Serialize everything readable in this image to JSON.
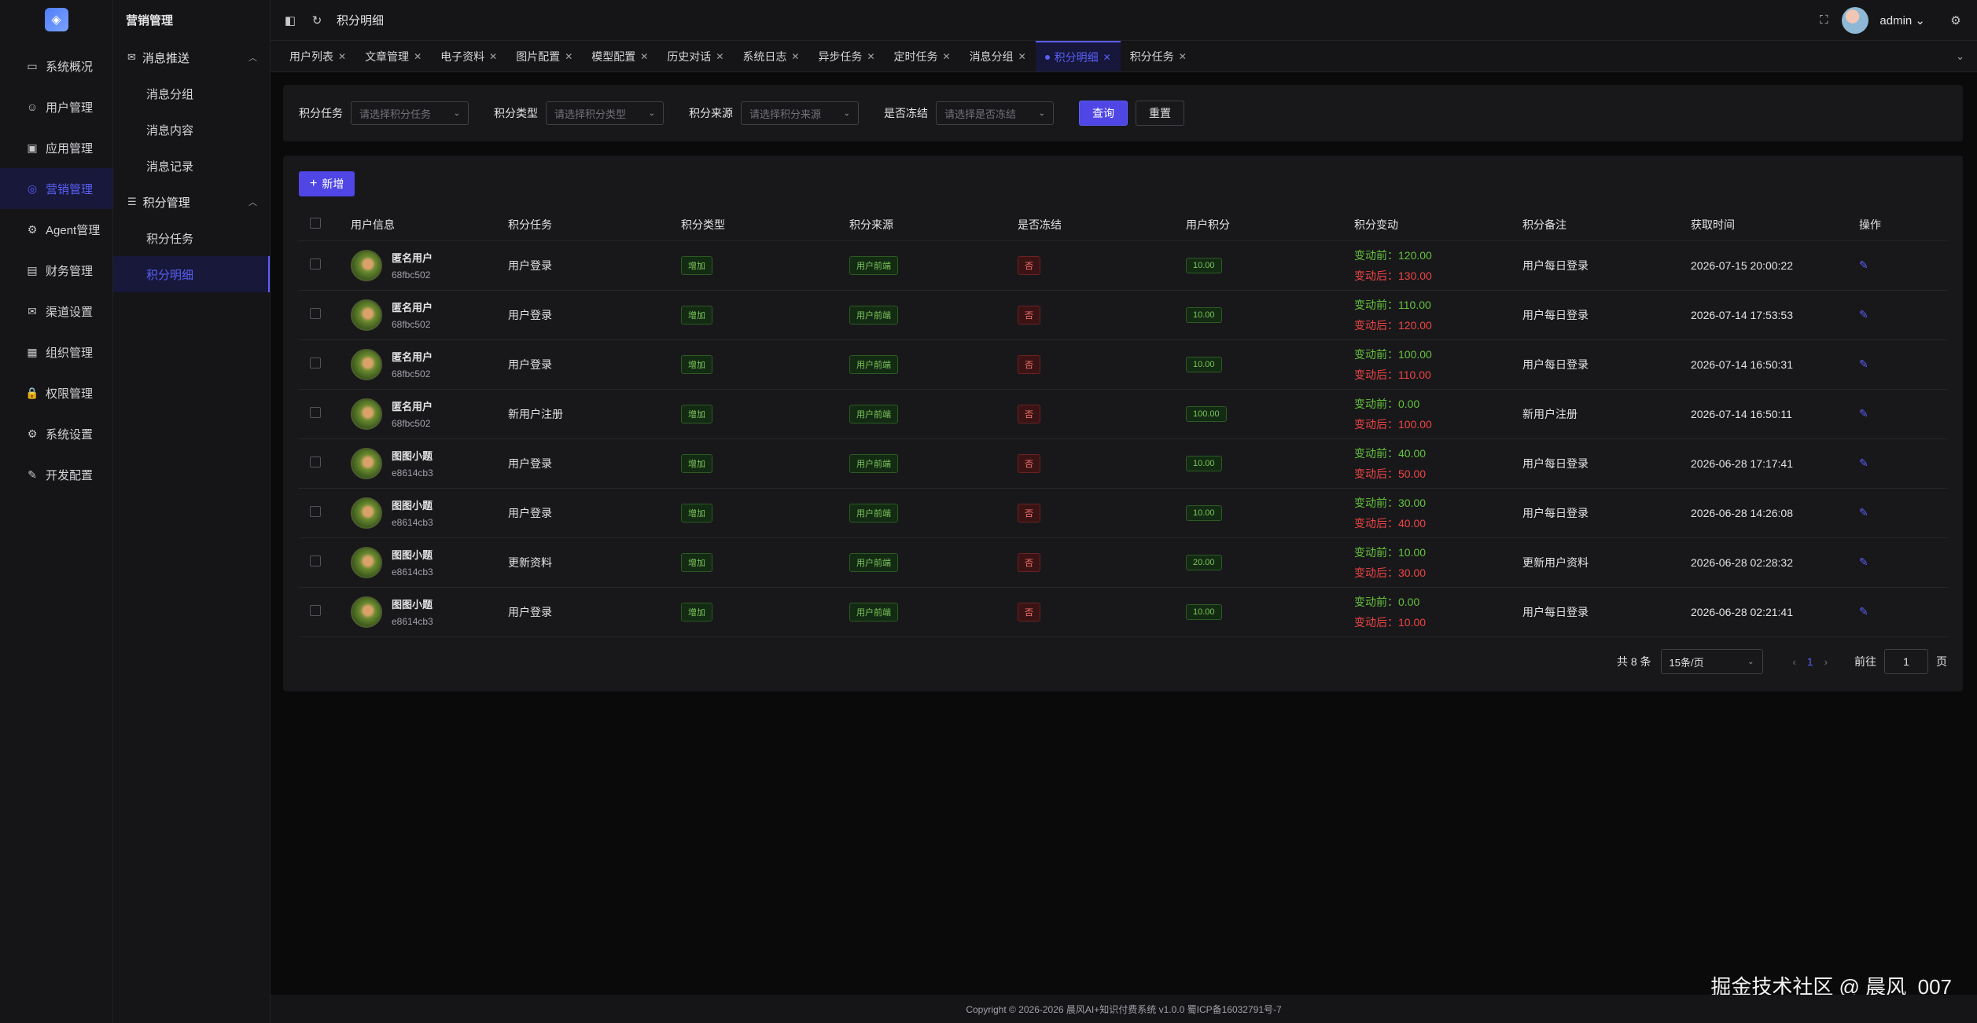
{
  "rail": {
    "items": [
      {
        "label": "系统概况",
        "icon": "monitor-icon",
        "glyph": "▭"
      },
      {
        "label": "用户管理",
        "icon": "user-icon",
        "glyph": "☺"
      },
      {
        "label": "应用管理",
        "icon": "app-icon",
        "glyph": "▣"
      },
      {
        "label": "营销管理",
        "icon": "marketing-icon",
        "glyph": "◎",
        "active": true
      },
      {
        "label": "Agent管理",
        "icon": "agent-icon",
        "glyph": "⚙"
      },
      {
        "label": "财务管理",
        "icon": "finance-icon",
        "glyph": "▤"
      },
      {
        "label": "渠道设置",
        "icon": "mail-icon",
        "glyph": "✉"
      },
      {
        "label": "组织管理",
        "icon": "org-icon",
        "glyph": "▦"
      },
      {
        "label": "权限管理",
        "icon": "lock-icon",
        "glyph": "🔒"
      },
      {
        "label": "系统设置",
        "icon": "gear-icon",
        "glyph": "⚙"
      },
      {
        "label": "开发配置",
        "icon": "edit-icon",
        "glyph": "✎"
      }
    ]
  },
  "submenu": {
    "title": "营销管理",
    "group1": {
      "label": "消息推送"
    },
    "group1_items": [
      "消息分组",
      "消息内容",
      "消息记录"
    ],
    "group2": {
      "label": "积分管理"
    },
    "group2_items": [
      "积分任务",
      "积分明细"
    ]
  },
  "topbar": {
    "breadcrumb": "积分明细",
    "user": "admin"
  },
  "tabs": [
    "用户列表",
    "文章管理",
    "电子资料",
    "图片配置",
    "模型配置",
    "历史对话",
    "系统日志",
    "异步任务",
    "定时任务",
    "消息分组",
    "积分明细",
    "积分任务"
  ],
  "active_tab": "积分明细",
  "filter": {
    "task_label": "积分任务",
    "task_placeholder": "请选择积分任务",
    "type_label": "积分类型",
    "type_placeholder": "请选择积分类型",
    "source_label": "积分来源",
    "source_placeholder": "请选择积分来源",
    "frozen_label": "是否冻结",
    "frozen_placeholder": "请选择是否冻结",
    "query": "查询",
    "reset": "重置"
  },
  "add_button": "新增",
  "table": {
    "headers": [
      "用户信息",
      "积分任务",
      "积分类型",
      "积分来源",
      "是否冻结",
      "用户积分",
      "积分变动",
      "积分备注",
      "获取时间",
      "操作"
    ],
    "before_prefix": "变动前：",
    "after_prefix": "变动后：",
    "rows": [
      {
        "name": "匿名用户",
        "id": "68fbc502",
        "task": "用户登录",
        "type": "增加",
        "source": "用户前端",
        "frozen": "否",
        "points": "10.00",
        "before": "120.00",
        "after": "130.00",
        "note": "用户每日登录",
        "time": "2026-07-15 20:00:22"
      },
      {
        "name": "匿名用户",
        "id": "68fbc502",
        "task": "用户登录",
        "type": "增加",
        "source": "用户前端",
        "frozen": "否",
        "points": "10.00",
        "before": "110.00",
        "after": "120.00",
        "note": "用户每日登录",
        "time": "2026-07-14 17:53:53"
      },
      {
        "name": "匿名用户",
        "id": "68fbc502",
        "task": "用户登录",
        "type": "增加",
        "source": "用户前端",
        "frozen": "否",
        "points": "10.00",
        "before": "100.00",
        "after": "110.00",
        "note": "用户每日登录",
        "time": "2026-07-14 16:50:31"
      },
      {
        "name": "匿名用户",
        "id": "68fbc502",
        "task": "新用户注册",
        "type": "增加",
        "source": "用户前端",
        "frozen": "否",
        "points": "100.00",
        "before": "0.00",
        "after": "100.00",
        "note": "新用户注册",
        "time": "2026-07-14 16:50:11"
      },
      {
        "name": "图图小题",
        "id": "e8614cb3",
        "task": "用户登录",
        "type": "增加",
        "source": "用户前端",
        "frozen": "否",
        "points": "10.00",
        "before": "40.00",
        "after": "50.00",
        "note": "用户每日登录",
        "time": "2026-06-28 17:17:41"
      },
      {
        "name": "图图小题",
        "id": "e8614cb3",
        "task": "用户登录",
        "type": "增加",
        "source": "用户前端",
        "frozen": "否",
        "points": "10.00",
        "before": "30.00",
        "after": "40.00",
        "note": "用户每日登录",
        "time": "2026-06-28 14:26:08"
      },
      {
        "name": "图图小题",
        "id": "e8614cb3",
        "task": "更新资料",
        "type": "增加",
        "source": "用户前端",
        "frozen": "否",
        "points": "20.00",
        "before": "10.00",
        "after": "30.00",
        "note": "更新用户资料",
        "time": "2026-06-28 02:28:32"
      },
      {
        "name": "图图小题",
        "id": "e8614cb3",
        "task": "用户登录",
        "type": "增加",
        "source": "用户前端",
        "frozen": "否",
        "points": "10.00",
        "before": "0.00",
        "after": "10.00",
        "note": "用户每日登录",
        "time": "2026-06-28 02:21:41"
      }
    ]
  },
  "pager": {
    "total": "共 8 条",
    "size": "15条/页",
    "page": "1",
    "goto": "前往",
    "input": "1",
    "unit": "页"
  },
  "footer": "Copyright © 2026-2026 晨风AI+知识付费系统 v1.0.0  蜀ICP备16032791号-7",
  "brand_watermark": "掘金技术社区 @ 晨风_007",
  "colors": {
    "accent": "#5b5ff7",
    "positive": "#65c23b",
    "negative": "#ef4444"
  }
}
